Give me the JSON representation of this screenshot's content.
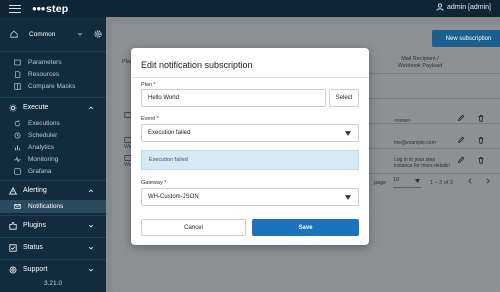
{
  "header": {
    "logo_text": "step",
    "user_label": "admin [admin]"
  },
  "sidebar": {
    "project": "Common",
    "items_top": [
      "Parameters",
      "Resources",
      "Compare Masks"
    ],
    "sections": [
      {
        "title": "Execute",
        "items": [
          "Executions",
          "Scheduler",
          "Analytics",
          "Monitoring",
          "Grafana"
        ]
      },
      {
        "title": "Alerting",
        "items": [
          "Notifications"
        ]
      },
      {
        "title": "Plugins",
        "items": []
      },
      {
        "title": "Status",
        "items": []
      },
      {
        "title": "Support",
        "items": []
      }
    ],
    "active_item": "Notifications",
    "version": "3.21.0"
  },
  "background": {
    "new_button": "New subscription",
    "column_plan": "Plan",
    "column_recipient": "Mail Recipient /\nWebhook Payload",
    "row1_recipient": "<none>",
    "row2_recipient": "me@example.com",
    "row3_recipient": "Log in to your step\ninstance for more details!",
    "row2_left": "Wen",
    "row3_left": "Wen",
    "pager_label": "page",
    "pager_size": "10",
    "pager_count": "1 – 3 of 3"
  },
  "modal": {
    "title": "Edit notification subscription",
    "plan_label": "Plan *",
    "plan_value": "Hello World",
    "select_button": "Select",
    "event_label": "Event *",
    "event_value": "Execution failed",
    "event_info": "Execution failed",
    "gateway_label": "Gateway *",
    "gateway_value": "WH-Custom-JSON",
    "cancel": "Cancel",
    "save": "Save"
  },
  "colors": {
    "sidebar": "#132c3d",
    "primary": "#1c73bd",
    "info_bg": "#d7e9f2"
  }
}
